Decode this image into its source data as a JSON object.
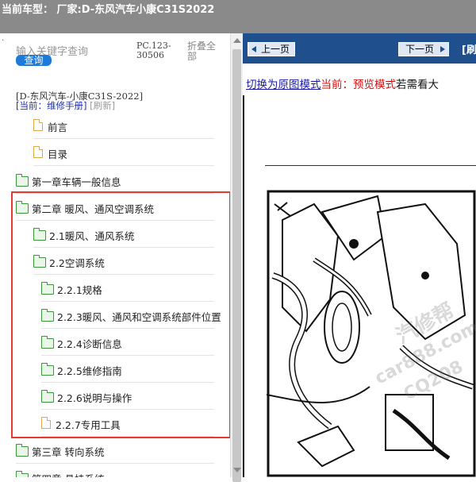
{
  "header": {
    "title": "当前车型： 厂家:D-东风汽车小康C31S2022"
  },
  "sidebar": {
    "search_placeholder": "输入关键字查询",
    "query_button": "查询",
    "code": "PC.123-30506",
    "fold_all": "折叠全部",
    "car_name": "[D-东风汽车-小康C31S-2022]",
    "current_prefix": "[当前：维修手册]",
    "refresh": "[刷新]",
    "items": [
      {
        "label": "前言",
        "icon": "file-icon"
      },
      {
        "label": "目录",
        "icon": "file-icon"
      },
      {
        "label": "第一章车辆一般信息",
        "icon": "folder-icon"
      },
      {
        "label": "第二章 暖风、通风空调系统",
        "icon": "folder-open-icon"
      },
      {
        "label": "2.1暖风、通风系统",
        "icon": "folder-icon"
      },
      {
        "label": "2.2空调系统",
        "icon": "folder-open-icon"
      },
      {
        "label": "2.2.1规格",
        "icon": "folder-icon"
      },
      {
        "label": "2.2.3暖风、通风和空调系统部件位置",
        "icon": "folder-icon"
      },
      {
        "label": "2.2.4诊断信息",
        "icon": "folder-icon"
      },
      {
        "label": "2.2.5维修指南",
        "icon": "folder-icon"
      },
      {
        "label": "2.2.6说明与操作",
        "icon": "folder-icon"
      },
      {
        "label": "2.2.7专用工具",
        "icon": "file-icon"
      },
      {
        "label": "第三章 转向系统",
        "icon": "folder-icon"
      },
      {
        "label": "第四章 悬挂系统",
        "icon": "folder-icon"
      }
    ]
  },
  "viewer": {
    "prev_label": "上一页",
    "next_label": "下一页",
    "nav_extra": "[刷",
    "switch_link": "切换为原图模式",
    "current_mode": "当前：预览模式",
    "note": "若需看大",
    "watermark_1": "汽修帮",
    "watermark_2": "car888.com",
    "watermark_3": "CQ208"
  },
  "colors": {
    "accent": "#1f4f8c",
    "highlight_box": "#e53935",
    "folder": "#3a9a3a",
    "file": "#e3a64a"
  }
}
